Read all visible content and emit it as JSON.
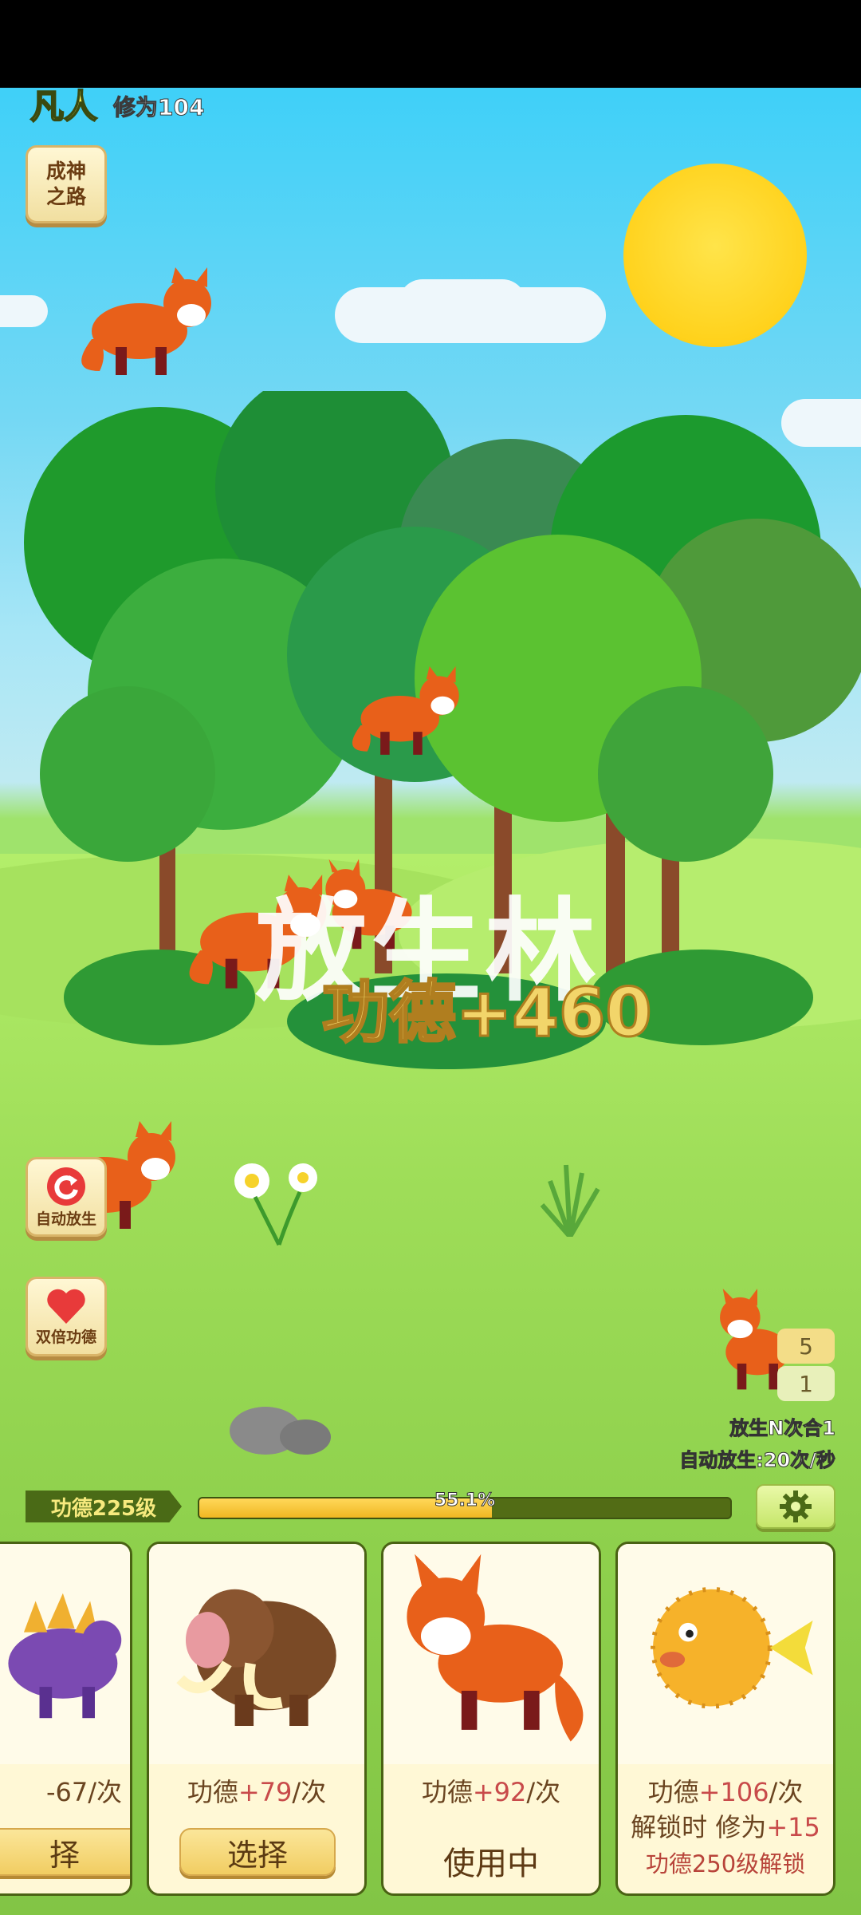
{
  "player": {
    "rank": "凡人",
    "cultivation": "修为104"
  },
  "buttons": {
    "road_to_god": "成神之路",
    "auto_release": "自动放生",
    "double_merit": "双倍功德"
  },
  "scene": {
    "place_title": "放生林",
    "merit_popup": "功德+460"
  },
  "counters": {
    "top": "5",
    "bottom": "1"
  },
  "info": {
    "release_combo": "放生N次合1",
    "auto_rate": "自动放生:20次/秒"
  },
  "merit_level": {
    "label": "功德225级",
    "progress_text": "55.1%",
    "progress": 0.551
  },
  "cards": [
    {
      "animal": "stegosaurus",
      "cost_prefix": "-67/次",
      "action": "择"
    },
    {
      "animal": "mammoth",
      "cost_prefix": "功德",
      "cost_value": "+79",
      "cost_suffix": "/次",
      "action": "选择"
    },
    {
      "animal": "fox",
      "cost_prefix": "功德",
      "cost_value": "+92",
      "cost_suffix": "/次",
      "status": "使用中"
    },
    {
      "animal": "pufferfish",
      "cost_prefix": "功德",
      "cost_value": "+106",
      "cost_suffix": "/次",
      "unlock_prefix": "解锁时 修为",
      "unlock_value": "+15",
      "unlock_requirement": "功德250级解锁"
    }
  ],
  "icons": {
    "refresh": "refresh-icon",
    "heart": "heart-icon",
    "gear": "gear-icon"
  }
}
